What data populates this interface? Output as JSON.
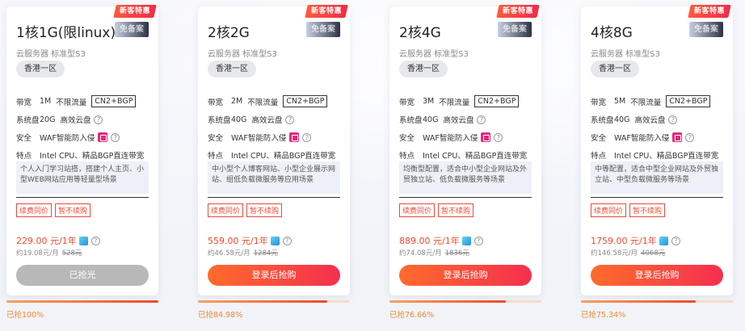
{
  "labels": {
    "bandwidth": "带宽",
    "disk": "系统盘",
    "security": "安全",
    "features": "特点",
    "question": "?"
  },
  "plans": [
    {
      "ribbon": "新客特惠",
      "title": "1核1G(限linux)",
      "exempt": "免备案",
      "subtitle": "云服务器 标准型S3",
      "region": "香港一区",
      "bw": "1M",
      "flow": "不限流量",
      "line": "CN2+BGP",
      "disk_size": "20G",
      "disk_type": "高效云盘",
      "waf": "WAF智能防入侵",
      "feat": "Intel CPU、精品BGP直连带宽",
      "desc": "个人入门学习站搭，搭建个人主页、小型WEB网站应用等轻量型场景",
      "tag1": "续费同价",
      "tag2": "暂不续购",
      "price": "229.00 元/1年",
      "monthly": "约19.08元/月",
      "orig": "528元",
      "button": "已抢光",
      "sold": "已抢100%",
      "progress": 1.0
    },
    {
      "ribbon": "新客特惠",
      "title": "2核2G",
      "exempt": "免备案",
      "subtitle": "云服务器 标准型S3",
      "region": "香港一区",
      "bw": "2M",
      "flow": "不限流量",
      "line": "CN2+BGP",
      "disk_size": "40G",
      "disk_type": "高效云盘",
      "waf": "WAF智能防入侵",
      "feat": "Intel CPU、精品BGP直连带宽",
      "desc": "中小型个人博客网站、小型企业展示网站、组低负载微服务等应用场景",
      "tag1": "续费同价",
      "tag2": "暂不续购",
      "price": "559.00 元/1年",
      "monthly": "约46.58元/月",
      "orig": "1284元",
      "button": "登录后抢购",
      "sold": "已抢84.98%",
      "progress": 0.8498
    },
    {
      "ribbon": "新客特惠",
      "title": "2核4G",
      "exempt": "免备案",
      "subtitle": "云服务器 标准型S3",
      "region": "香港一区",
      "bw": "3M",
      "flow": "不限流量",
      "line": "CN2+BGP",
      "disk_size": "40G",
      "disk_type": "高效云盘",
      "waf": "WAF智能防入侵",
      "feat": "Intel CPU、精品BGP直连带宽",
      "desc": "均衡型配置，适合中小型企业网站及外贸独立站、低负载微服务等场景",
      "tag1": "续费同价",
      "tag2": "暂不续购",
      "price": "889.00 元/1年",
      "monthly": "约74.08元/月",
      "orig": "1836元",
      "button": "登录后抢购",
      "sold": "已抢76.66%",
      "progress": 0.7666
    },
    {
      "ribbon": "新客特惠",
      "title": "4核8G",
      "exempt": "免备案",
      "subtitle": "云服务器 标准型S3",
      "region": "香港一区",
      "bw": "5M",
      "flow": "不限流量",
      "line": "CN2+BGP",
      "disk_size": "40G",
      "disk_type": "高效云盘",
      "waf": "WAF智能防入侵",
      "feat": "Intel CPU、精品BGP直连带宽",
      "desc": "中等配置，适合中型企业网站及外贸独立站、中型负载微服务等场景",
      "tag1": "续费同价",
      "tag2": "暂不续购",
      "price": "1759.00 元/1年",
      "monthly": "约146.58元/月",
      "orig": "4068元",
      "button": "登录后抢购",
      "sold": "已抢75.34%",
      "progress": 0.7534
    }
  ],
  "colors": {
    "accent": "#ef4a2e",
    "soldout": "#b8b8b8"
  }
}
